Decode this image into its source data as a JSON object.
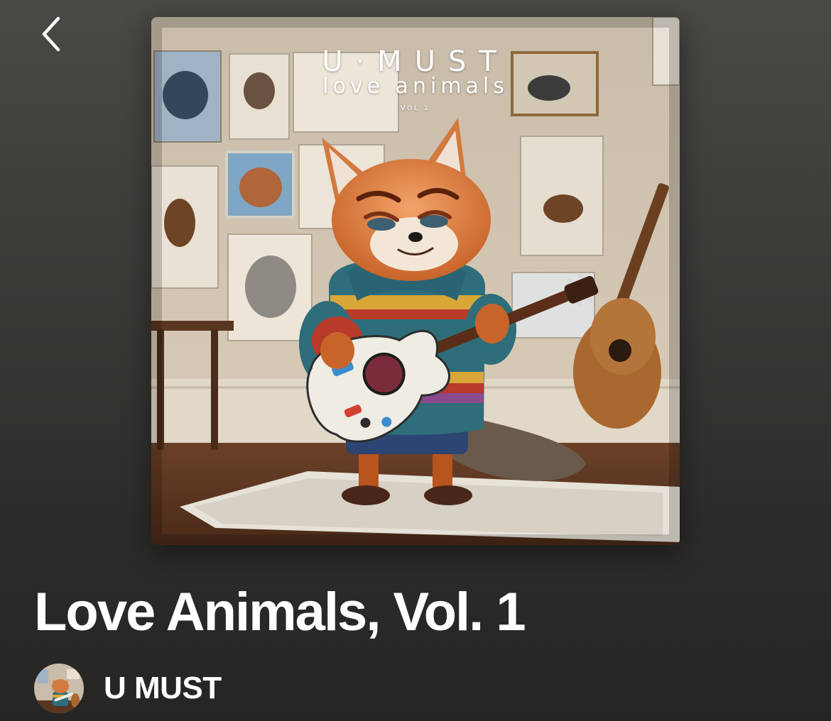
{
  "nav": {
    "back_icon": "chevron-left-icon"
  },
  "album": {
    "cover_art": {
      "artist_text": "U·MUST",
      "title_text": "love animals",
      "volume_text": "VOL 1"
    },
    "title": "Love Animals, Vol. 1",
    "artist": {
      "name": "U MUST",
      "avatar_icon": "artist-avatar"
    }
  },
  "colors": {
    "background_top": "#4a4945",
    "background_bottom": "#262524",
    "text": "#ffffff"
  }
}
